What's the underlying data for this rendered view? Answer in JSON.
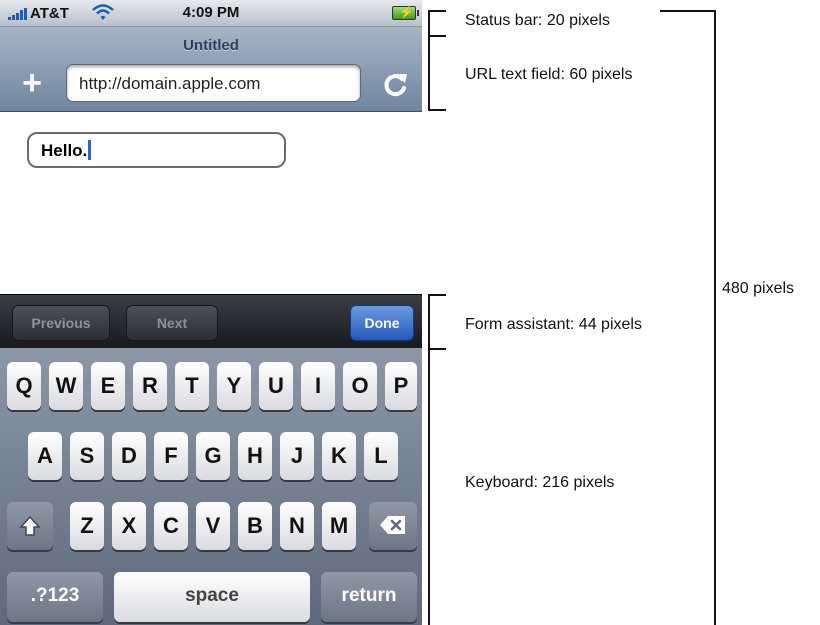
{
  "status_bar": {
    "carrier": "AT&T",
    "time": "4:09 PM"
  },
  "browser": {
    "page_title": "Untitled",
    "add_label": "+",
    "url_value": "http://domain.apple.com"
  },
  "form": {
    "input_value": "Hello."
  },
  "form_assistant": {
    "previous_label": "Previous",
    "next_label": "Next",
    "done_label": "Done"
  },
  "keyboard": {
    "row1": [
      "Q",
      "W",
      "E",
      "R",
      "T",
      "Y",
      "U",
      "I",
      "O",
      "P"
    ],
    "row2": [
      "A",
      "S",
      "D",
      "F",
      "G",
      "H",
      "J",
      "K",
      "L"
    ],
    "row3": [
      "Z",
      "X",
      "C",
      "V",
      "B",
      "N",
      "M"
    ],
    "numbers_label": ".?123",
    "space_label": "space",
    "return_label": "return"
  },
  "annotations": {
    "status_bar": "Status bar: 20 pixels",
    "url_field": "URL text field: 60 pixels",
    "form_assistant": "Form assistant: 44 pixels",
    "keyboard": "Keyboard: 216 pixels",
    "total": "480 pixels"
  },
  "colors": {
    "nav_bar": "#8497ae",
    "done_button": "#2f63c4",
    "caret": "#2a60d8",
    "keyboard_bg": "#77818f"
  }
}
